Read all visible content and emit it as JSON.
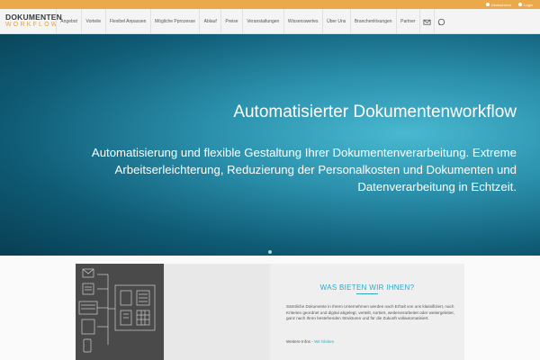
{
  "topbar": {
    "language": "Deutschland",
    "login": "Login"
  },
  "logo": {
    "line1": "DOKUMENTEN",
    "line2": "WORKFLOW"
  },
  "nav": {
    "items": [
      "Angebot",
      "Vorteile",
      "Flexibel Anpassen",
      "Mögliche Pprozesse",
      "Ablauf",
      "Preise",
      "Veranstaltungen",
      "Wissenswertes",
      "Über Uns",
      "Branchenlösungen",
      "Partner"
    ],
    "icons": [
      "mail-icon",
      "whatsapp-icon"
    ]
  },
  "hero": {
    "title": "Automatisierter Dokumentenworkflow",
    "subtitle": "Automatisierung und flexible Gestaltung Ihrer Dokumentenverarbeitung. Extreme Arbeitserleichterung, Reduzierung der Personalkosten und Dokumenten und Datenverarbeitung in Echtzeit."
  },
  "offer": {
    "title": "WAS BIETEN WIR IHNEN?",
    "body": "Sämtliche Dokumente in Ihrem Unternehmen werden nach Erhalt von uns klassifiziert, nach Kriterien geordnet und digital abgelegt, verteilt, sortiert, weiterverarbeitet oder weitergeleitet, ganz nach Ihren bestehenden Strukturen und für die Zukunft vollautomatisiert.",
    "more_label": "Weitere Infos - ",
    "more_link": "Wir klicken"
  },
  "colors": {
    "accent_orange": "#eaa94a",
    "accent_blue": "#33a6c2"
  }
}
